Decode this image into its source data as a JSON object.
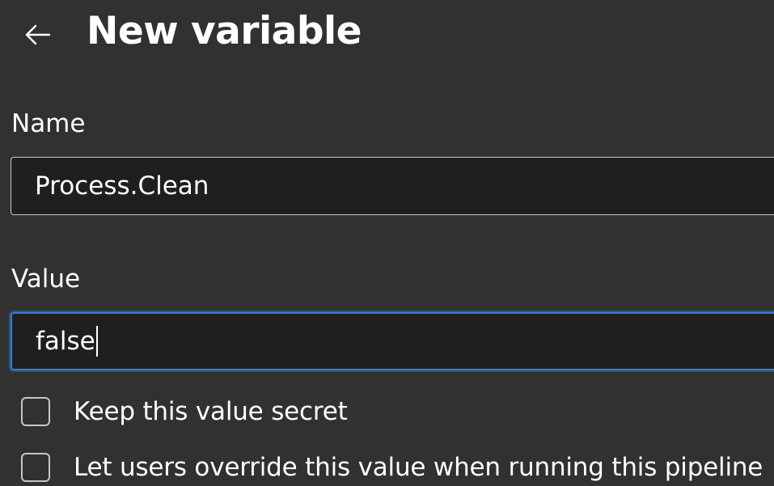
{
  "header": {
    "title": "New variable",
    "back_icon": "arrow-left-icon"
  },
  "form": {
    "name": {
      "label": "Name",
      "value": "Process.Clean"
    },
    "value": {
      "label": "Value",
      "value": "false",
      "focused": true
    },
    "options": [
      {
        "label": "Keep this value secret",
        "checked": false
      },
      {
        "label": "Let users override this value when running this pipeline",
        "checked": false
      }
    ]
  },
  "colors": {
    "background": "#323130",
    "input_background": "#1f1f1f",
    "focus_border": "#2f7fd6",
    "border": "#c8c6c4",
    "text": "#ffffff"
  }
}
